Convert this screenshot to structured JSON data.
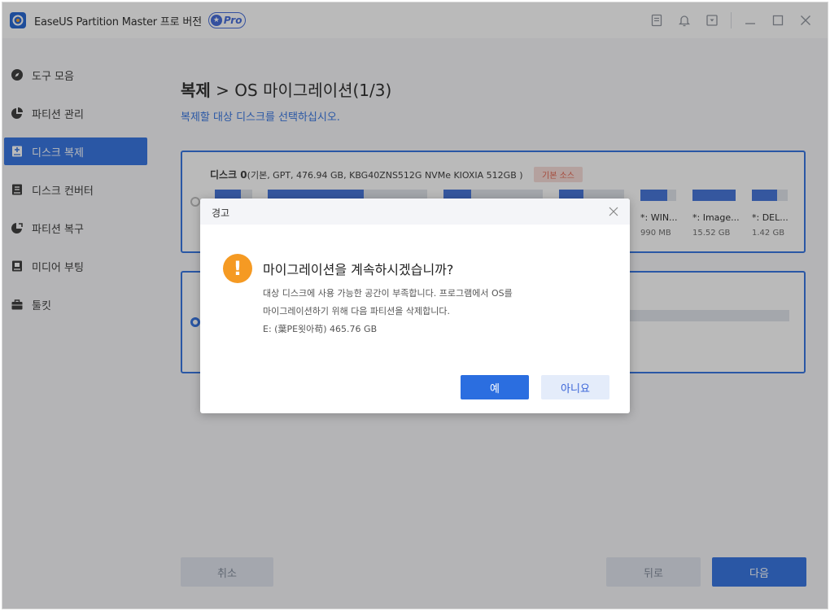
{
  "app": {
    "title": "EaseUS Partition Master 프로 버전",
    "pro_label": "Pro"
  },
  "colors": {
    "accent": "#2b6ee0",
    "warning": "#f59a23",
    "source_badge_bg": "#f7dad6",
    "source_badge_text": "#e05a44"
  },
  "titlebar_icons": [
    "feedback-icon",
    "bell-icon",
    "dropdown-menu-icon",
    "minimize-icon",
    "maximize-icon",
    "close-icon"
  ],
  "sidebar": {
    "items": [
      {
        "label": "도구 모음",
        "icon": "compass-icon",
        "active": false
      },
      {
        "label": "파티션 관리",
        "icon": "pie-chart-icon",
        "active": false
      },
      {
        "label": "디스크 복제",
        "icon": "disk-clone-icon",
        "active": true
      },
      {
        "label": "디스크 컨버터",
        "icon": "disk-convert-icon",
        "active": false
      },
      {
        "label": "파티션 복구",
        "icon": "partition-recovery-icon",
        "active": false
      },
      {
        "label": "미디어 부팅",
        "icon": "boot-media-icon",
        "active": false
      },
      {
        "label": "툴킷",
        "icon": "toolbox-icon",
        "active": false
      }
    ]
  },
  "main": {
    "title_bold": "복제",
    "title_sep": ">",
    "title_rest": "OS 마이그레이션(1/3)",
    "subtitle": "복제할 대상 디스크를 선택하십시오.",
    "disk0": {
      "name": "디스크 0",
      "info": "(기본, GPT, 476.94 GB, KBG40ZNS512G NVMe KIOXIA 512GB )",
      "badge": "기본 소스",
      "partitions": [
        {
          "label": "*: WIN...",
          "size": "990 MB",
          "fill": 0.75
        },
        {
          "label": "*: Image...",
          "size": "15.52 GB",
          "fill": 1.0
        },
        {
          "label": "*: DEL...",
          "size": "1.42 GB",
          "fill": 0.7
        }
      ]
    },
    "buttons": {
      "cancel": "취소",
      "back": "뒤로",
      "next": "다음"
    }
  },
  "dialog": {
    "title": "경고",
    "heading": "마이그레이션을 계속하시겠습니까?",
    "line1": "대상 디스크에 사용 가능한 공간이 부족합니다. 프로그램에서 OS를",
    "line2": "마이그레이션하기 위해 다음 파티션을 삭제합니다.",
    "line3": "E: (葉PE욋아苟) 465.76 GB",
    "yes": "예",
    "no": "아니요"
  }
}
